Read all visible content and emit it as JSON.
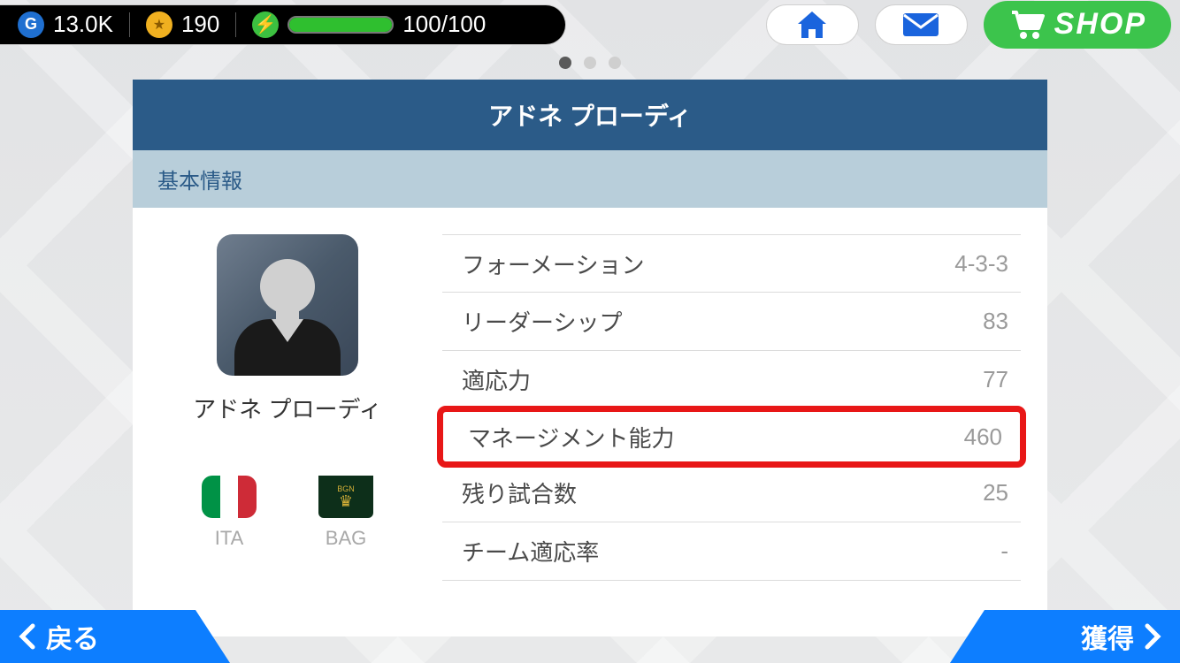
{
  "topbar": {
    "gold_currency": "13.0K",
    "coin_currency": "190",
    "energy_text": "100/100",
    "shop_label": "SHOP"
  },
  "dots": {
    "active_index": 0,
    "count": 3
  },
  "card": {
    "title": "アドネ プローディ",
    "subtitle": "基本情報",
    "coach_name": "アドネ プローディ",
    "nation_code": "ITA",
    "club_code": "BAG",
    "club_badge_text": "BGN",
    "stats": [
      {
        "label": "フォーメーション",
        "value": "4-3-3"
      },
      {
        "label": "リーダーシップ",
        "value": "83"
      },
      {
        "label": "適応力",
        "value": "77"
      },
      {
        "label": "マネージメント能力",
        "value": "460",
        "highlighted": true
      },
      {
        "label": "残り試合数",
        "value": "25"
      },
      {
        "label": "チーム適応率",
        "value": "-"
      }
    ]
  },
  "nav": {
    "back_label": "戻る",
    "acquire_label": "獲得"
  }
}
